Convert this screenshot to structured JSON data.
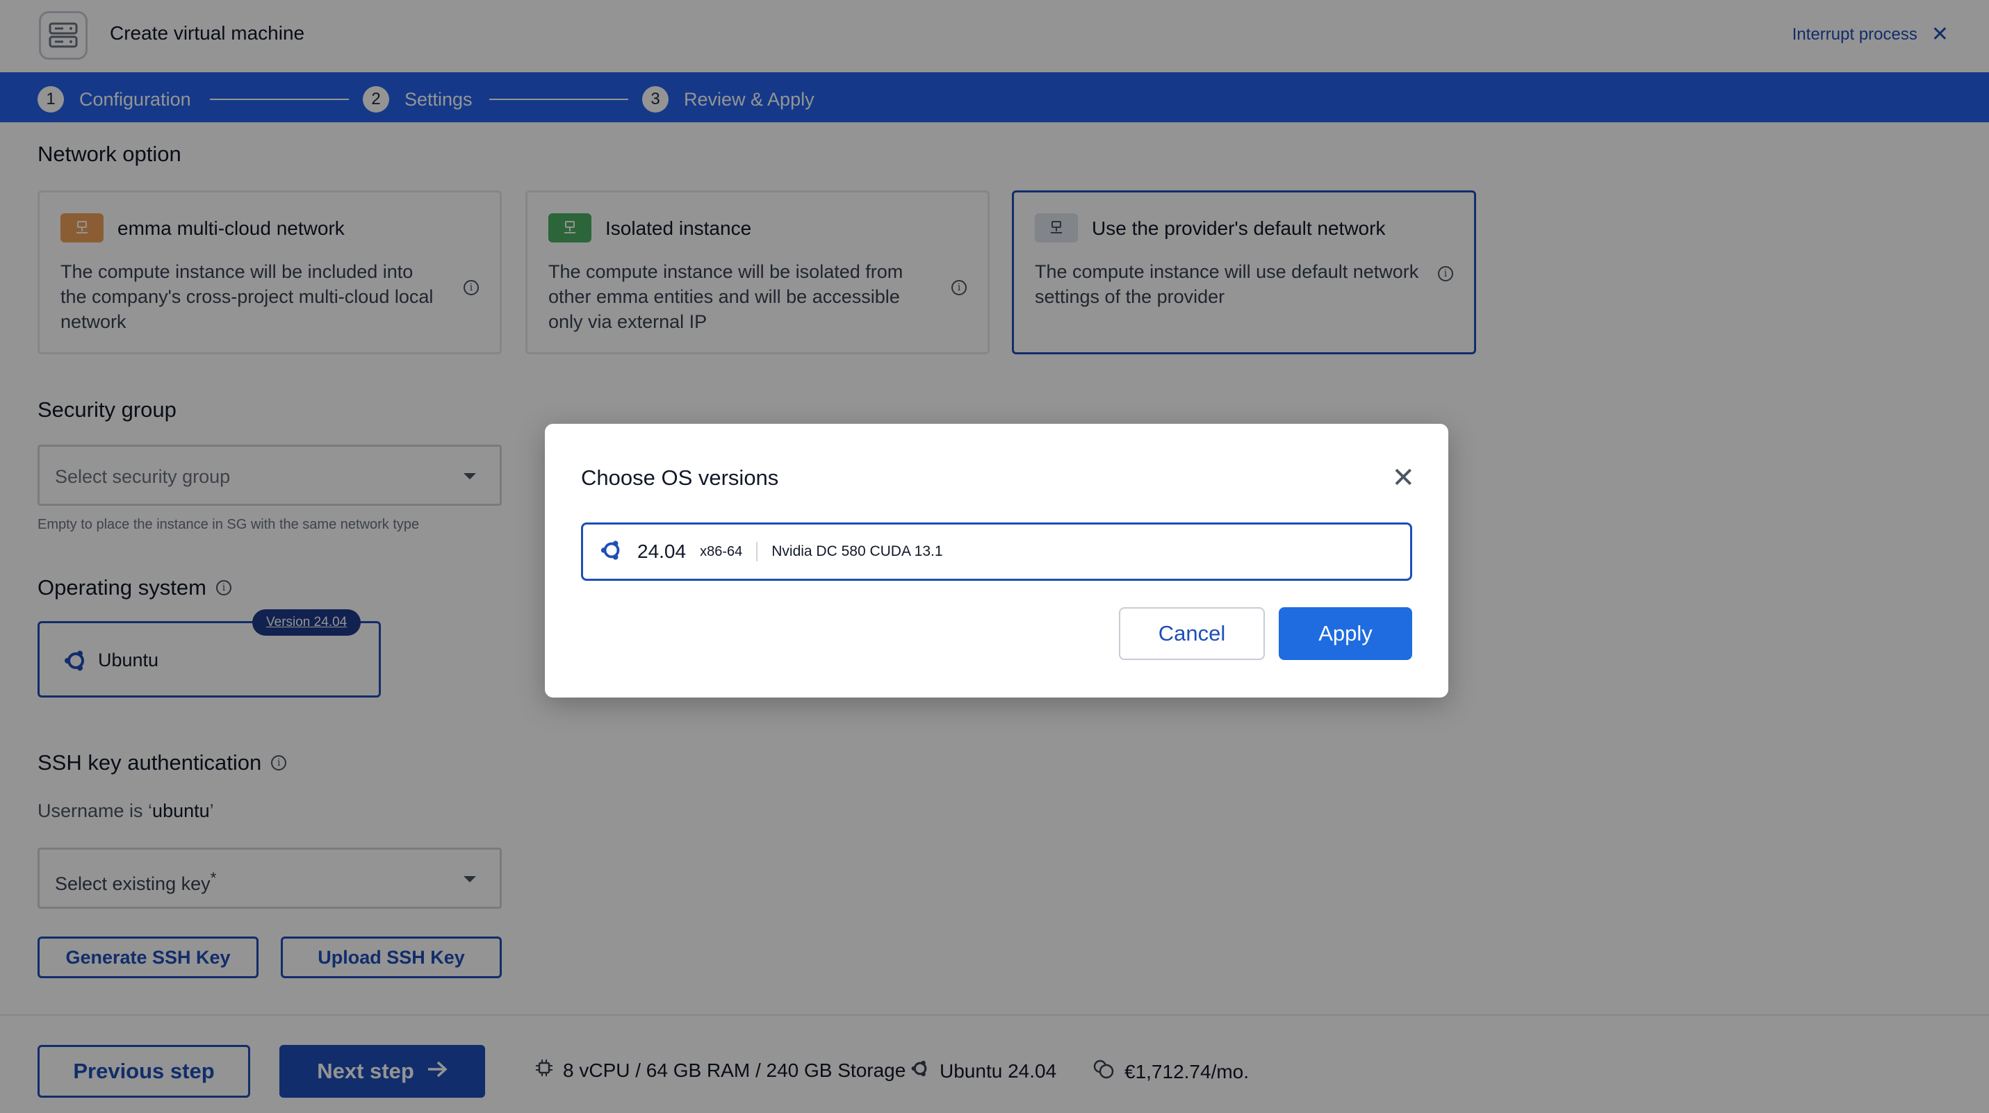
{
  "header": {
    "title": "Create virtual machine",
    "interrupt_label": "Interrupt process"
  },
  "stepper": {
    "steps": [
      {
        "number": "1",
        "label": "Configuration"
      },
      {
        "number": "2",
        "label": "Settings"
      },
      {
        "number": "3",
        "label": "Review & Apply"
      }
    ]
  },
  "network": {
    "title": "Network option",
    "options": [
      {
        "title": "emma multi-cloud network",
        "description": "The compute instance will be included into the company's cross-project multi-cloud local network",
        "badge_color": "#f0a15a"
      },
      {
        "title": "Isolated instance",
        "description": "The compute instance will be isolated from other emma entities and will be accessible only via external IP",
        "badge_color": "#4caf65"
      },
      {
        "title": "Use the provider's default network",
        "description": "The compute instance will use default network settings of the provider",
        "badge_color": "#dfe3ea"
      }
    ]
  },
  "security": {
    "title": "Security group",
    "placeholder": "Select security group",
    "hint": "Empty to place the instance in SG with the same network type"
  },
  "os": {
    "title": "Operating system",
    "name": "Ubuntu",
    "version_badge": "Version 24.04"
  },
  "ssh": {
    "title": "SSH key authentication",
    "username_prefix": "Username is ‘",
    "username": "ubuntu",
    "username_suffix": "’",
    "key_placeholder": "Select existing key",
    "required_mark": "*",
    "generate_label": "Generate SSH Key",
    "upload_label": "Upload SSH Key"
  },
  "footer": {
    "prev_label": "Previous step",
    "next_label": "Next step",
    "specs": "8 vCPU / 64 GB RAM / 240 GB Storage",
    "os_summary": "Ubuntu 24.04",
    "price": "€1,712.74/mo."
  },
  "modal": {
    "title": "Choose OS versions",
    "version": "24.04",
    "arch": "x86-64",
    "description": "Nvidia DC 580 CUDA 13.1",
    "cancel_label": "Cancel",
    "apply_label": "Apply"
  },
  "colors": {
    "primary": "#1e4fb8",
    "stepper": "#2563eb",
    "apply": "#1e6ce0"
  }
}
